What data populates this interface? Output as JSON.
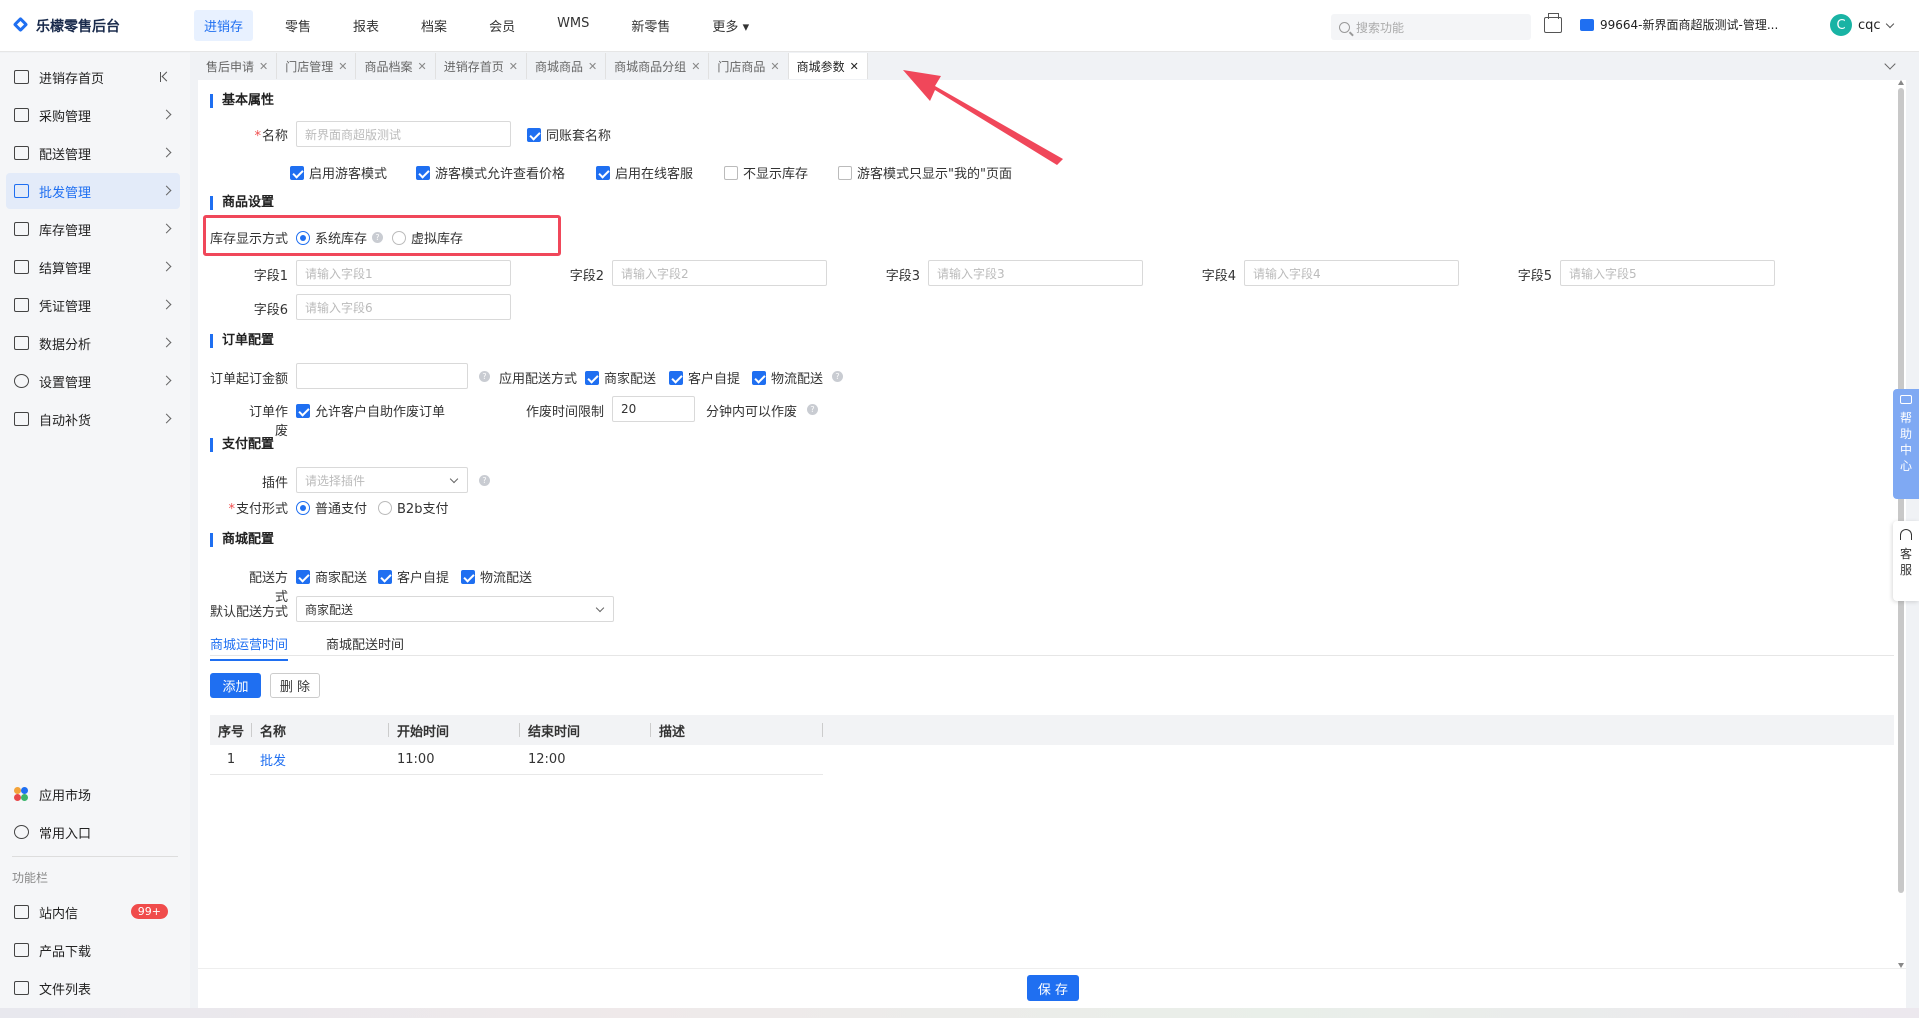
{
  "app": {
    "title": "乐檬零售后台"
  },
  "topnav": [
    "进销存",
    "零售",
    "报表",
    "档案",
    "会员",
    "WMS",
    "新零售",
    "更多"
  ],
  "search": {
    "placeholder": "搜索功能"
  },
  "store": {
    "label": "99664-新界面商超版测试-管理..."
  },
  "user": {
    "initial": "C",
    "name": "cqc"
  },
  "sidebar": {
    "items": [
      {
        "label": "进销存首页"
      },
      {
        "label": "采购管理"
      },
      {
        "label": "配送管理"
      },
      {
        "label": "批发管理"
      },
      {
        "label": "库存管理"
      },
      {
        "label": "结算管理"
      },
      {
        "label": "凭证管理"
      },
      {
        "label": "数据分析"
      },
      {
        "label": "设置管理"
      },
      {
        "label": "自动补货"
      }
    ],
    "bottom": {
      "app_market": "应用市场",
      "common_entry": "常用入口",
      "section_label": "功能栏",
      "messages": "站内信",
      "messages_badge": "99+",
      "downloads": "产品下载",
      "file_list": "文件列表"
    }
  },
  "tabs": [
    "售后申请",
    "门店管理",
    "商品档案",
    "进销存首页",
    "商城商品",
    "商城商品分组",
    "门店商品",
    "商城参数"
  ],
  "basic": {
    "title": "基本属性",
    "name_label": "名称",
    "name_placeholder": "新界面商超版测试",
    "same_account_name": "同账套名称",
    "options": [
      "启用游客模式",
      "游客模式允许查看价格",
      "启用在线客服",
      "不显示库存",
      "游客模式只显示\"我的\"页面"
    ]
  },
  "goods": {
    "title": "商品设置",
    "stock_display_label": "库存显示方式",
    "stock_system": "系统库存",
    "stock_virtual": "虚拟库存",
    "fields": [
      {
        "label": "字段1",
        "placeholder": "请输入字段1"
      },
      {
        "label": "字段2",
        "placeholder": "请输入字段2"
      },
      {
        "label": "字段3",
        "placeholder": "请输入字段3"
      },
      {
        "label": "字段4",
        "placeholder": "请输入字段4"
      },
      {
        "label": "字段5",
        "placeholder": "请输入字段5"
      },
      {
        "label": "字段6",
        "placeholder": "请输入字段6"
      }
    ]
  },
  "order": {
    "title": "订单配置",
    "min_amount_label": "订单起订金额",
    "delivery_methods_label": "应用配送方式",
    "delivery_methods": [
      "商家配送",
      "客户自提",
      "物流配送"
    ],
    "void_label": "订单作废",
    "void_option": "允许客户自助作废订单",
    "void_time_label": "作废时间限制",
    "void_time_value": "20",
    "void_time_suffix": "分钟内可以作废"
  },
  "payment": {
    "title": "支付配置",
    "plugin_label": "插件",
    "plugin_placeholder": "请选择插件",
    "form_label": "支付形式",
    "form_normal": "普通支付",
    "form_b2b": "B2b支付"
  },
  "mall": {
    "title": "商城配置",
    "delivery_label": "配送方式",
    "delivery_options": [
      "商家配送",
      "客户自提",
      "物流配送"
    ],
    "default_delivery_label": "默认配送方式",
    "default_delivery_value": "商家配送",
    "subtabs": [
      "商城运营时间",
      "商城配送时间"
    ],
    "add_button": "添加",
    "delete_button": "删 除",
    "table": {
      "headers": [
        "序号",
        "名称",
        "开始时间",
        "结束时间",
        "描述"
      ],
      "rows": [
        {
          "index": "1",
          "name": "批发",
          "start": "11:00",
          "end": "12:00",
          "desc": ""
        }
      ]
    }
  },
  "footer": {
    "save_button": "保 存"
  },
  "floating": {
    "help_center": [
      "帮",
      "助",
      "中",
      "心"
    ],
    "customer_service": [
      "客",
      "服"
    ]
  },
  "colors": {
    "accent": "#1f6ff1",
    "highlight": "#f0475a",
    "badge": "#f04c4c"
  }
}
